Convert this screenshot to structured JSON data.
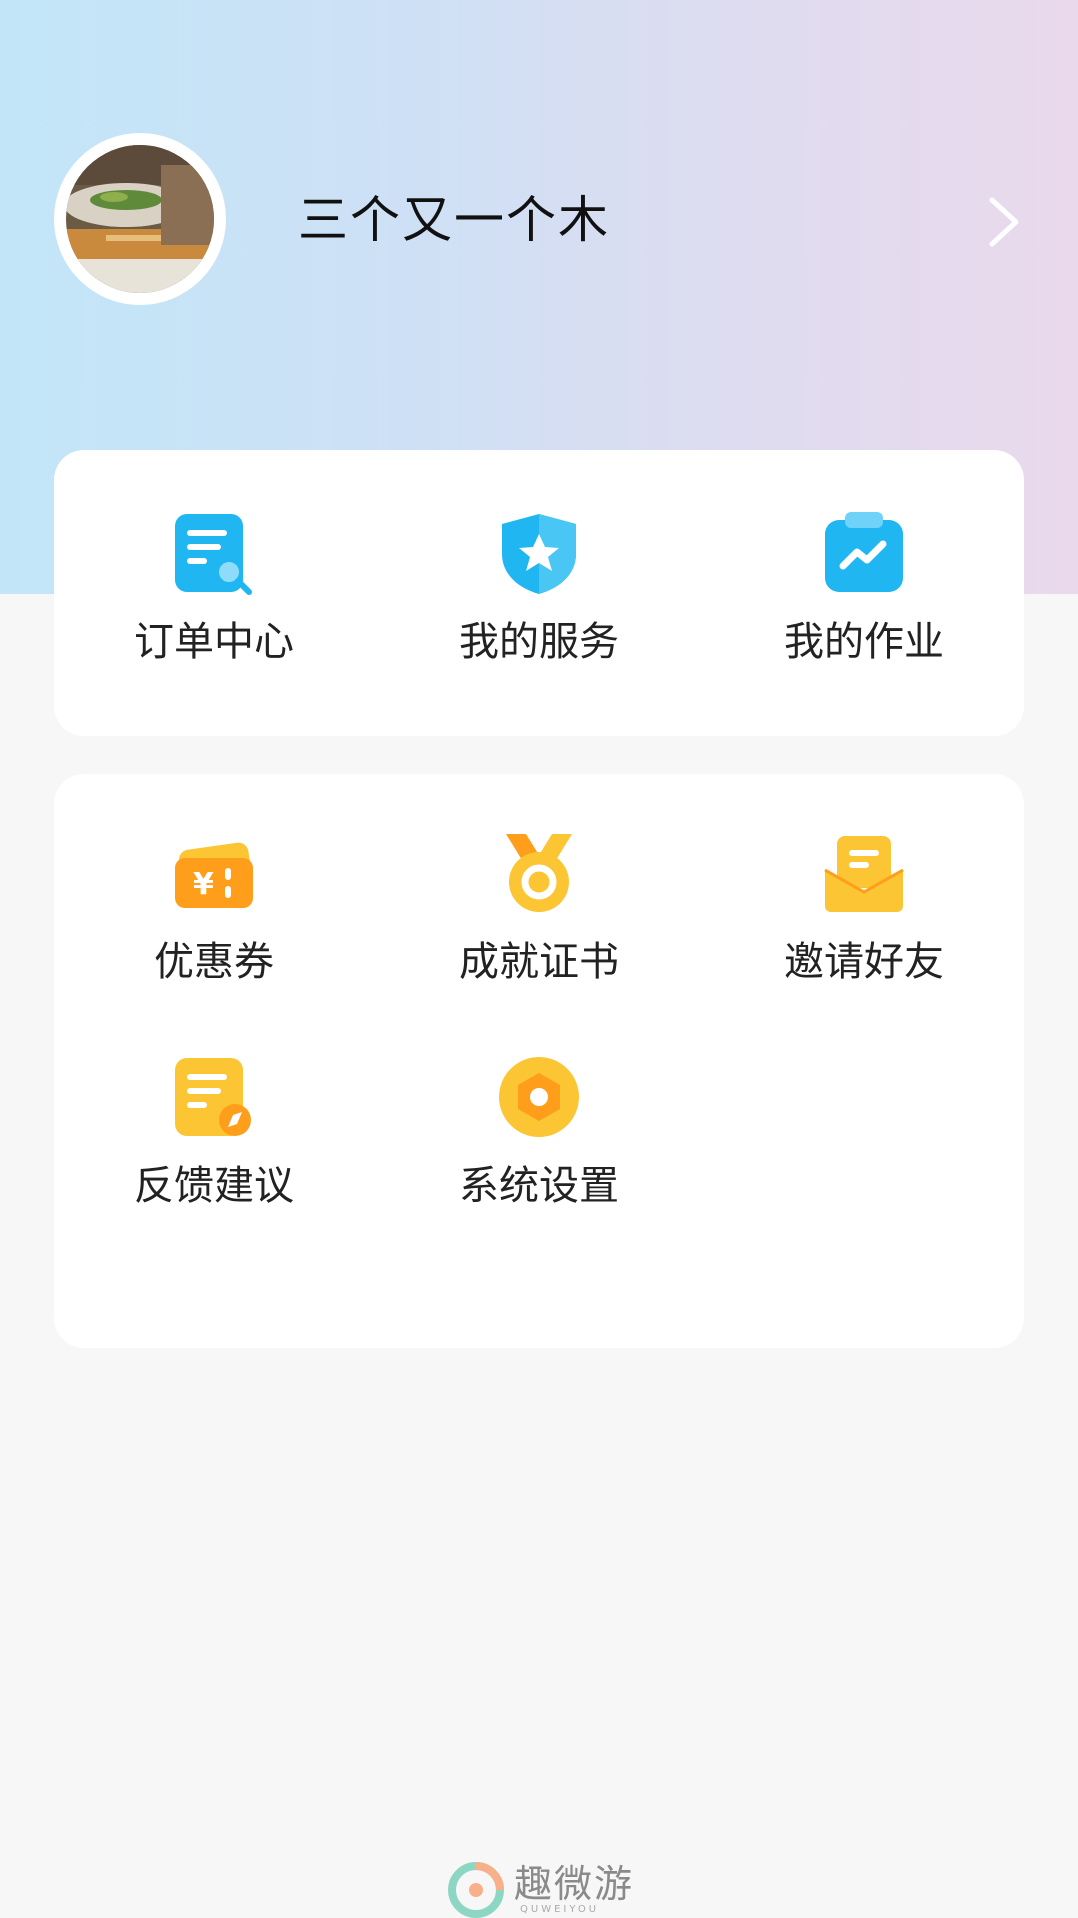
{
  "profile": {
    "username": "三个又一个木"
  },
  "services_card": {
    "items": [
      {
        "label": "订单中心",
        "icon": "order-search-icon"
      },
      {
        "label": "我的服务",
        "icon": "shield-star-icon"
      },
      {
        "label": "我的作业",
        "icon": "clipboard-chart-icon"
      }
    ]
  },
  "tools_card": {
    "items": [
      {
        "label": "优惠券",
        "icon": "coupon-yen-icon"
      },
      {
        "label": "成就证书",
        "icon": "medal-icon"
      },
      {
        "label": "邀请好友",
        "icon": "envelope-icon"
      },
      {
        "label": "反馈建议",
        "icon": "feedback-document-icon"
      },
      {
        "label": "系统设置",
        "icon": "settings-hex-icon"
      }
    ]
  },
  "watermark": {
    "text": "趣微游",
    "subtext": "QUWEIYOU"
  },
  "colors": {
    "blue_icon": "#1fb6f2",
    "yellow_icon": "#fbc533",
    "orange_icon": "#ff9e1b"
  }
}
